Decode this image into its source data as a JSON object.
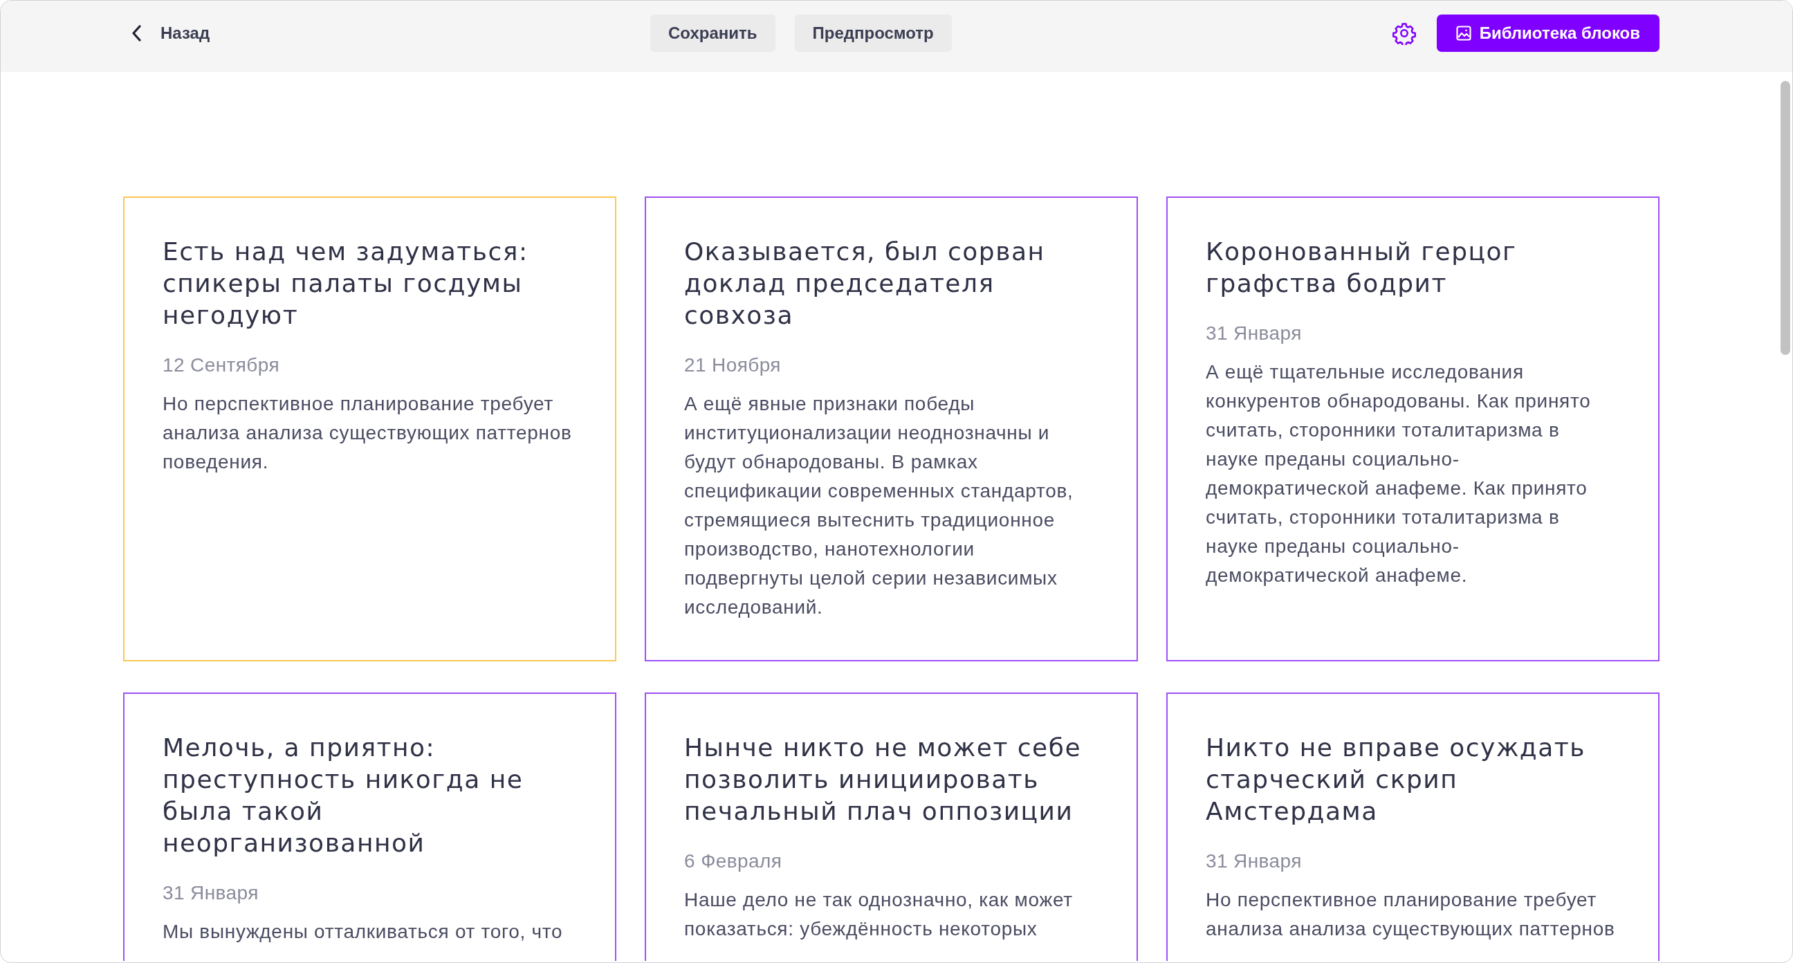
{
  "toolbar": {
    "back_link": {
      "label": "Назад"
    },
    "buttons": [
      {
        "label": "Сохранить"
      },
      {
        "label": "Предпросмотр"
      }
    ],
    "library_button": {
      "label": "Библиотека блоков"
    }
  },
  "cards": [
    {
      "title": "Есть над чем задуматься: спикеры палаты госдумы негодуют",
      "date": "12 Сентября",
      "text": "Но перспективное планирование требует анализа анализа существующих паттернов поведения.",
      "selected": true
    },
    {
      "title": "Оказывается, был сорван доклад председателя совхоза",
      "date": "21 Ноября",
      "text": "А ещё явные признаки победы институционализации неоднозначны и будут обнародованы. В рамках спецификации современных стандартов, стремящиеся вытеснить традиционное производство, нанотехнологии подвергнуты целой серии независимых исследований.",
      "selected": false
    },
    {
      "title": "Коронованный герцог графства бодрит",
      "date": "31 Января",
      "text": "А ещё тщательные исследования конкурентов обнародованы. Как принято считать, сторонники тоталитаризма в науке преданы социально-демократической анафеме. Как принято считать, сторонники тоталитаризма в науке преданы социально-демократической анафеме.",
      "selected": false
    },
    {
      "title": "Мелочь, а приятно: преступность никогда не была такой неорганизованной",
      "date": "31 Января",
      "text": "Мы вынуждены отталкиваться от того, что",
      "selected": false
    },
    {
      "title": "Нынче никто не может себе позволить инициировать печальный плач оппозиции",
      "date": "6 Февраля",
      "text": "Наше дело не так однозначно, как может показаться: убеждённость некоторых",
      "selected": false
    },
    {
      "title": "Никто не вправе осуждать старческий скрип Амстердама",
      "date": "31 Января",
      "text": "Но перспективное планирование требует анализа анализа существующих паттернов",
      "selected": false
    }
  ]
}
